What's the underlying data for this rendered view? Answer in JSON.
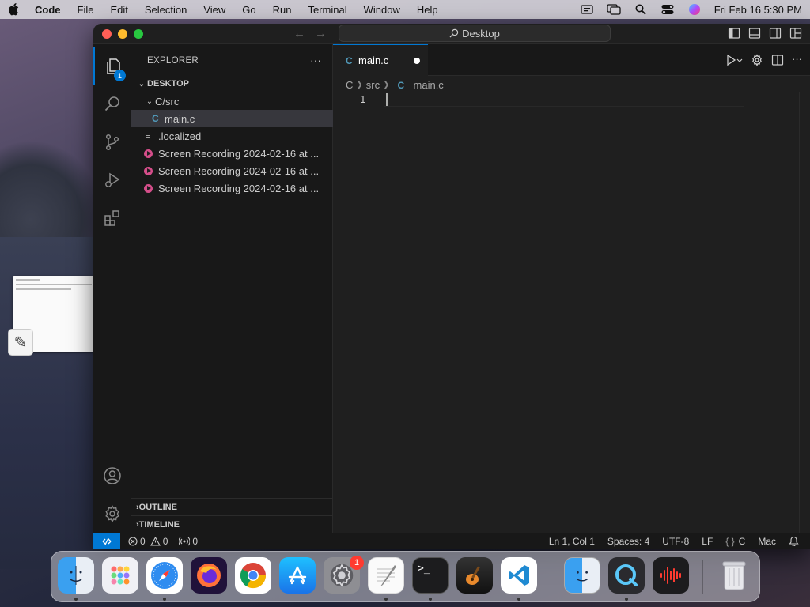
{
  "menubar": {
    "app_name": "Code",
    "items": [
      "File",
      "Edit",
      "Selection",
      "View",
      "Go",
      "Run",
      "Terminal",
      "Window",
      "Help"
    ],
    "datetime": "Fri Feb 16  5:30 PM"
  },
  "window": {
    "command_center": "Desktop"
  },
  "activity_bar": {
    "explorer_badge": "1"
  },
  "sidebar": {
    "header": "EXPLORER",
    "root": "DESKTOP",
    "folder": "C/src",
    "files": [
      {
        "name": "main.c",
        "type": "c",
        "selected": true
      },
      {
        "name": ".localized",
        "type": "text"
      },
      {
        "name": "Screen Recording 2024-02-16 at ...",
        "type": "video"
      },
      {
        "name": "Screen Recording 2024-02-16 at ...",
        "type": "video"
      },
      {
        "name": "Screen Recording 2024-02-16 at ...",
        "type": "video"
      }
    ],
    "outline": "OUTLINE",
    "timeline": "TIMELINE"
  },
  "editor": {
    "tab_label": "main.c",
    "breadcrumb": [
      "C",
      "src",
      "main.c"
    ],
    "line_number": "1"
  },
  "statusbar": {
    "errors": "0",
    "warnings": "0",
    "ports": "0",
    "position": "Ln 1, Col 1",
    "spaces": "Spaces: 4",
    "encoding": "UTF-8",
    "eol": "LF",
    "language": "C",
    "platform": "Mac"
  },
  "dock": {
    "settings_badge": "1"
  },
  "colors": {
    "accent": "#0078d4",
    "editor_bg": "#1f1f1f",
    "sidebar_bg": "#181818"
  }
}
